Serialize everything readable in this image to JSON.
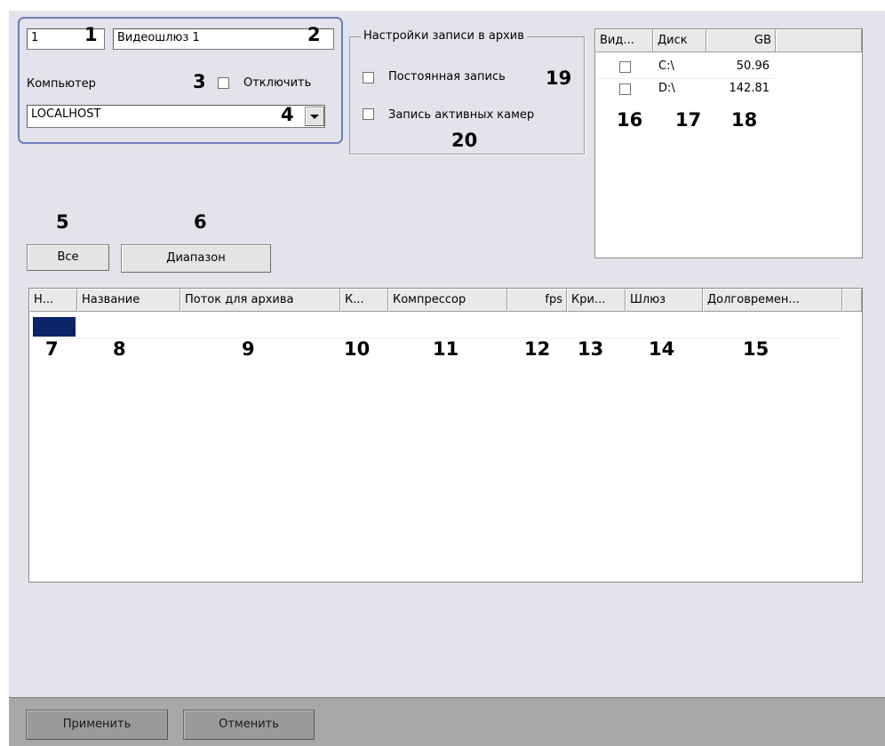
{
  "gateway": {
    "id_value": "1",
    "name_value": "Видеошлюз 1",
    "computer_label": "Компьютер",
    "disable_label": "Отключить",
    "computer_value": "LOCALHOST"
  },
  "archive_settings": {
    "group_label": "Настройки записи в архив",
    "permanent_label": "Постоянная запись",
    "active_cameras_label": "Запись активных камер"
  },
  "disks": {
    "headers": [
      "Вид...",
      "Диск",
      "GB"
    ],
    "rows": [
      {
        "disk": "C:\\",
        "gb": "50.96"
      },
      {
        "disk": "D:\\",
        "gb": "142.81"
      }
    ]
  },
  "buttons": {
    "all": "Все",
    "range": "Диапазон",
    "apply": "Применить",
    "cancel": "Отменить"
  },
  "cameras": {
    "headers": [
      "Н...",
      "Название",
      "Поток для архива",
      "К...",
      "Компрессор",
      "fps",
      "Кри...",
      "Шлюз",
      "Долговремен..."
    ]
  },
  "callouts": {
    "n1": "1",
    "n2": "2",
    "n3": "3",
    "n4": "4",
    "n5": "5",
    "n6": "6",
    "n7": "7",
    "n8": "8",
    "n9": "9",
    "n10": "10",
    "n11": "11",
    "n12": "12",
    "n13": "13",
    "n14": "14",
    "n15": "15",
    "n16": "16",
    "n17": "17",
    "n18": "18",
    "n19": "19",
    "n20": "20"
  },
  "colors": {
    "selection": "#0a246a",
    "panel_bg": "#e3e3ec",
    "frame_border": "#6f7fb8"
  },
  "icons": {
    "dropdown": "chevron-down-icon"
  }
}
